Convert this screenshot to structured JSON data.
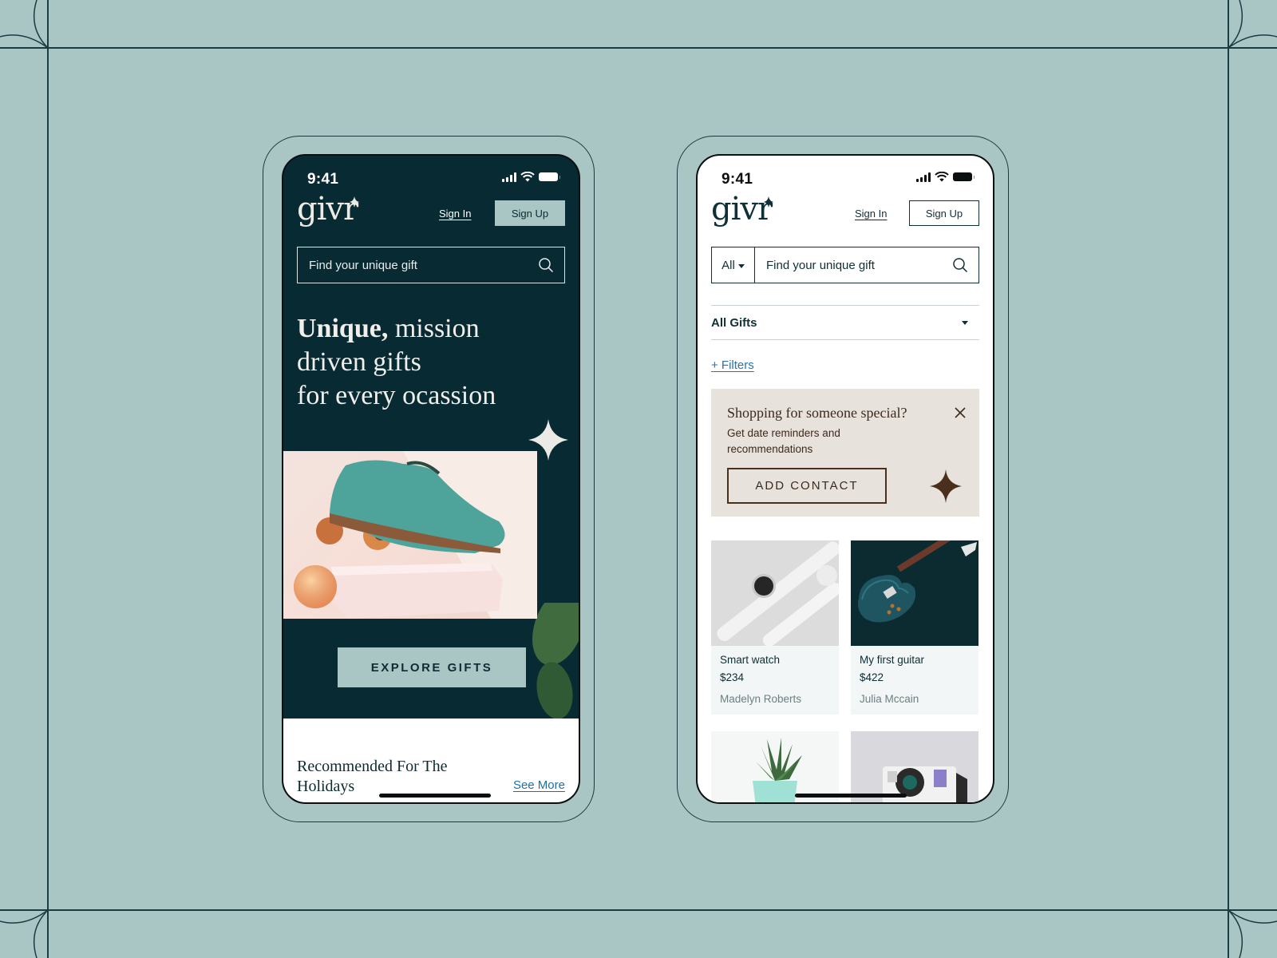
{
  "status_bar": {
    "time": "9:41"
  },
  "brand": {
    "name": "givr"
  },
  "colors": {
    "background": "#a9c5c4",
    "dark_teal": "#082a33",
    "accent_mint": "#a9c5c4",
    "link_blue": "#2a73a8",
    "promo_bg": "#e7e2dc",
    "promo_brown": "#4a2f1c"
  },
  "left_phone": {
    "nav": {
      "sign_in": "Sign In",
      "sign_up": "Sign Up"
    },
    "search": {
      "placeholder": "Find your unique gift",
      "icon": "search-icon"
    },
    "hero": {
      "title_bold": "Unique,",
      "title_rest_line1": " mission",
      "title_line2": "driven gifts",
      "title_line3": "for every ocassion",
      "image_alt": "Teal suede brogue shoe resting on apricots and a pink box",
      "cta": "EXPLORE GIFTS"
    },
    "recommended": {
      "title": "Recommended For The Holidays",
      "see_more": "See More"
    }
  },
  "right_phone": {
    "nav": {
      "sign_in": "Sign In",
      "sign_up": "Sign Up"
    },
    "search": {
      "scope": "All",
      "placeholder": "Find your unique gift",
      "icon": "search-icon"
    },
    "category": {
      "selected": "All Gifts"
    },
    "filters_link": "+ Filters",
    "promo": {
      "title": "Shopping for someone special?",
      "text": "Get date reminders and recommendations",
      "button": "ADD CONTACT",
      "close_icon": "close-icon"
    },
    "products": [
      {
        "name": "Smart watch",
        "price": "$234",
        "seller": "Madelyn Roberts",
        "image": "smart-watch-image"
      },
      {
        "name": "My first guitar",
        "price": "$422",
        "seller": "Julia Mccain",
        "image": "guitar-image"
      },
      {
        "image": "succulent-plant-image"
      },
      {
        "image": "instant-camera-image"
      }
    ]
  }
}
